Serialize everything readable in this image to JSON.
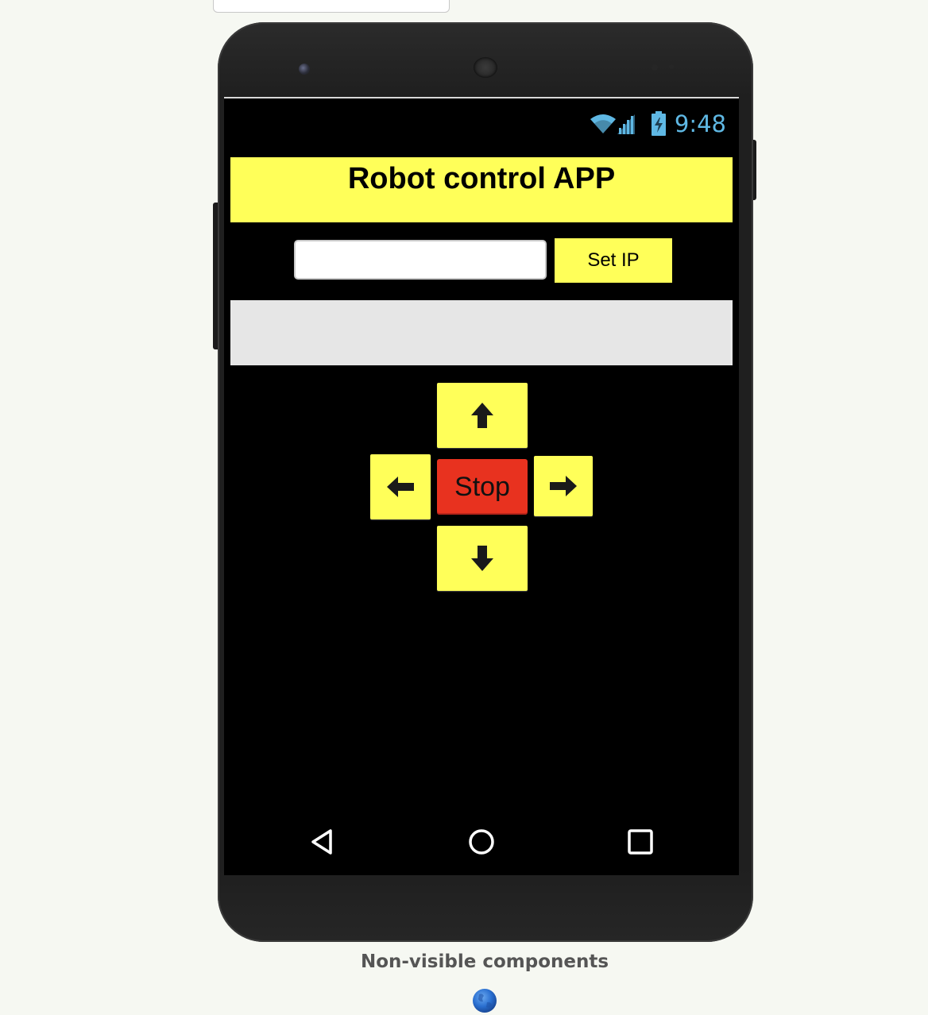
{
  "status_bar": {
    "time": "9:48",
    "icons": [
      "wifi-icon",
      "signal-icon",
      "battery-icon"
    ],
    "icon_color": "#5fb8e4"
  },
  "app": {
    "title": "Robot control APP",
    "ip_input": {
      "value": "",
      "placeholder": ""
    },
    "set_ip_label": "Set IP",
    "status_label": "",
    "controls": {
      "up_icon": "arrow-up-icon",
      "left_icon": "arrow-left-icon",
      "right_icon": "arrow-right-icon",
      "down_icon": "arrow-down-icon",
      "stop_label": "Stop"
    }
  },
  "nav_bar": {
    "items": [
      "back-icon",
      "home-icon",
      "recents-icon"
    ]
  },
  "designer": {
    "nonvisible_label": "Non-visible components",
    "nonvisible_icons": [
      "web-component-icon"
    ]
  },
  "colors": {
    "accent_yellow": "#ffff59",
    "stop_red": "#e8321f",
    "screen_bg": "#000000",
    "label_bg": "#e6e6e6",
    "page_bg": "#f6f8f2"
  }
}
